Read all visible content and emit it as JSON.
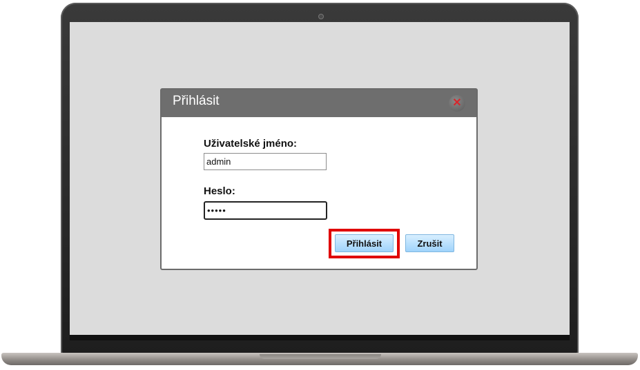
{
  "dialog": {
    "title": "Přihlásit",
    "close_icon": "close-icon",
    "username": {
      "label": "Uživatelské jméno:",
      "value": "admin"
    },
    "password": {
      "label": "Heslo:",
      "value": "•••••"
    },
    "buttons": {
      "login": "Přihlásit",
      "cancel": "Zrušit"
    },
    "highlight_color": "#e00000"
  },
  "colors": {
    "titlebar": "#6e6e6e",
    "screen_background": "#dcdcdc",
    "button_gradient_top": "#d8efff",
    "button_gradient_bottom": "#9fd3fb"
  }
}
